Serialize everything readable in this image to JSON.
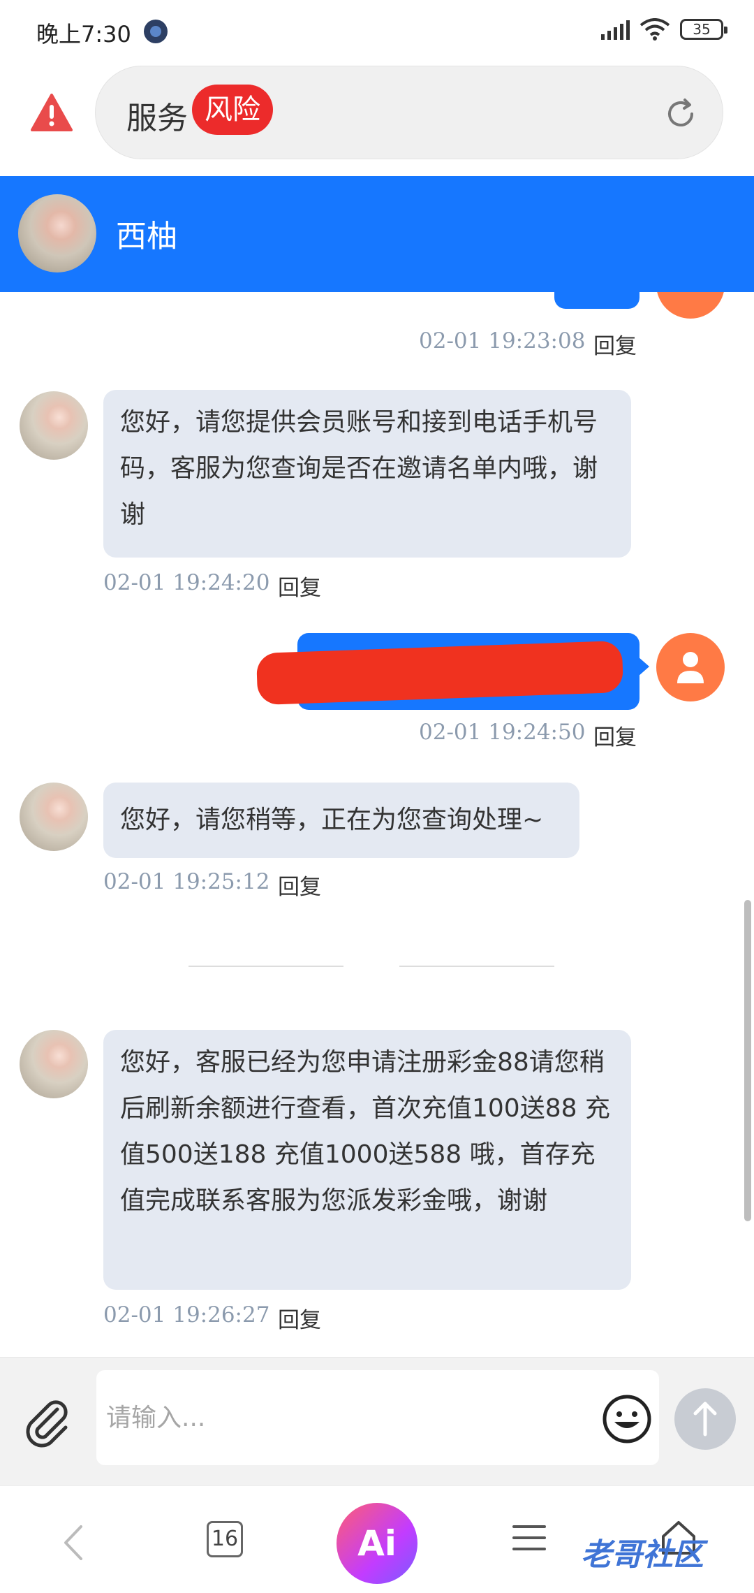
{
  "status_bar": {
    "time": "晚上7:30",
    "battery": "35"
  },
  "url_bar": {
    "title": "服务",
    "risk_badge": "风险"
  },
  "chat": {
    "contact_name": "西柚"
  },
  "messages": [
    {
      "from": "user",
      "timestamp": "02-01 19:23:08",
      "reply": "回复"
    },
    {
      "from": "agent",
      "text": "您好，请您提供会员账号和接到电话手机号码，客服为您查询是否在邀请名单内哦，谢谢",
      "timestamp": "02-01 19:24:20",
      "reply": "回复"
    },
    {
      "from": "user",
      "timestamp": "02-01 19:24:50",
      "reply": "回复"
    },
    {
      "from": "agent",
      "text": "您好，请您稍等，正在为您查询处理~",
      "timestamp": "02-01 19:25:12",
      "reply": "回复"
    },
    {
      "from": "agent",
      "text": "您好，客服已经为您申请注册彩金88请您稍后刷新余额进行查看，首次充值100送88 充值500送188 充值1000送588 哦，首存充值完成联系客服为您派发彩金哦，谢谢",
      "timestamp": "02-01 19:26:27",
      "reply": "回复"
    }
  ],
  "composer": {
    "placeholder": "请输入..."
  },
  "nav": {
    "tab_count": "16",
    "ai_label": "Ai"
  },
  "watermark": "老哥社区",
  "colors": {
    "header_blue": "#1677ff",
    "risk_red": "#ec2b2b",
    "bubble_gray": "#e4e9f2",
    "user_avatar": "#ff7a45"
  },
  "icons": [
    "warning-icon",
    "reload-icon",
    "user-icon",
    "paperclip-icon",
    "emoji-icon",
    "send-arrow-icon",
    "back-icon",
    "menu-icon",
    "home-icon"
  ]
}
